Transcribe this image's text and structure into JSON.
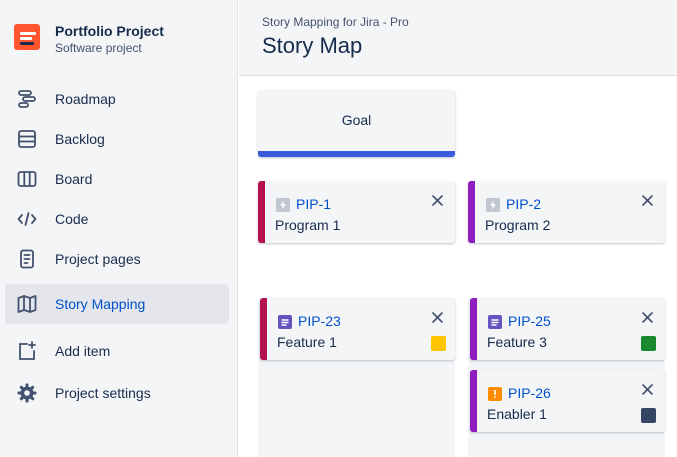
{
  "project": {
    "name": "Portfolio Project",
    "type": "Software project"
  },
  "nav": {
    "items": [
      {
        "label": "Roadmap",
        "icon": "roadmap-icon"
      },
      {
        "label": "Backlog",
        "icon": "backlog-icon"
      },
      {
        "label": "Board",
        "icon": "board-icon"
      },
      {
        "label": "Code",
        "icon": "code-icon"
      },
      {
        "label": "Project pages",
        "icon": "pages-icon"
      },
      {
        "label": "Story Mapping",
        "icon": "story-map-icon",
        "active": true
      },
      {
        "label": "Add item",
        "icon": "add-item-icon"
      },
      {
        "label": "Project settings",
        "icon": "gear-icon"
      }
    ]
  },
  "header": {
    "subtitle": "Story Mapping for Jira - Pro",
    "title": "Story Map"
  },
  "board": {
    "goal": {
      "label": "Goal",
      "color": "#3b5bdb"
    },
    "programs": [
      {
        "key": "PIP-1",
        "summary": "Program 1",
        "stripe": "#b5124f",
        "icon": "program-icon"
      },
      {
        "key": "PIP-2",
        "summary": "Program 2",
        "stripe": "#8e1ebd",
        "icon": "program-icon"
      }
    ],
    "features": [
      {
        "key": "PIP-23",
        "summary": "Feature 1",
        "stripe": "#b5124f",
        "icon": "story-icon",
        "swatch": "#ffc400"
      },
      {
        "key": "PIP-25",
        "summary": "Feature 3",
        "stripe": "#8e1ebd",
        "icon": "story-icon",
        "swatch": "#1b8a2e"
      },
      {
        "key": "PIP-26",
        "summary": "Enabler 1",
        "stripe": "#8e1ebd",
        "icon": "enabler-icon",
        "swatch": "#344563"
      }
    ]
  }
}
